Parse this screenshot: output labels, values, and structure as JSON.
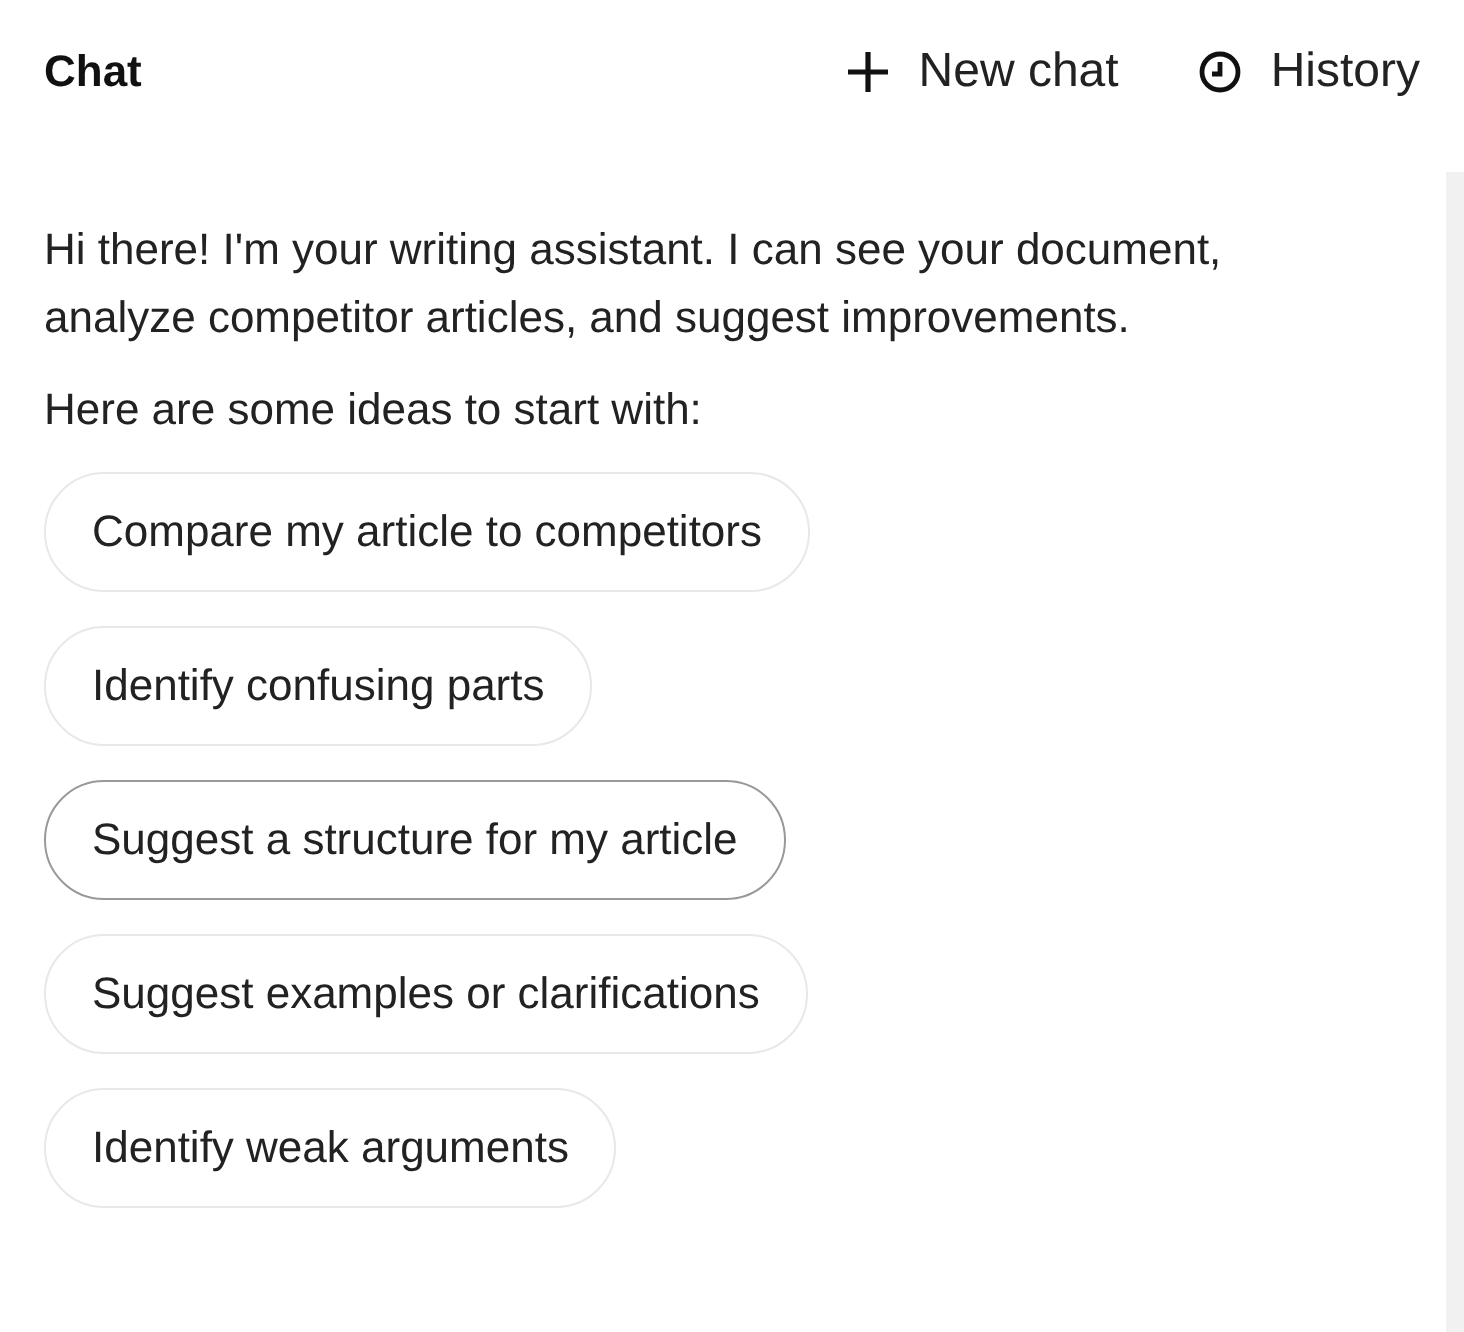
{
  "header": {
    "title": "Chat",
    "actions": [
      {
        "kind": "new",
        "label": "New chat"
      },
      {
        "kind": "history",
        "label": "History"
      }
    ]
  },
  "intro": "Hi there! I'm your writing assistant. I can see your document, analyze competitor articles, and suggest improvements.",
  "ideas_label": "Here are some ideas to start with:",
  "suggestions": [
    {
      "label": "Compare my article to competitors",
      "selected": false
    },
    {
      "label": "Identify confusing parts",
      "selected": false
    },
    {
      "label": "Suggest a structure for my article",
      "selected": true
    },
    {
      "label": "Suggest examples or clarifications",
      "selected": false
    },
    {
      "label": "Identify weak arguments",
      "selected": false
    }
  ]
}
